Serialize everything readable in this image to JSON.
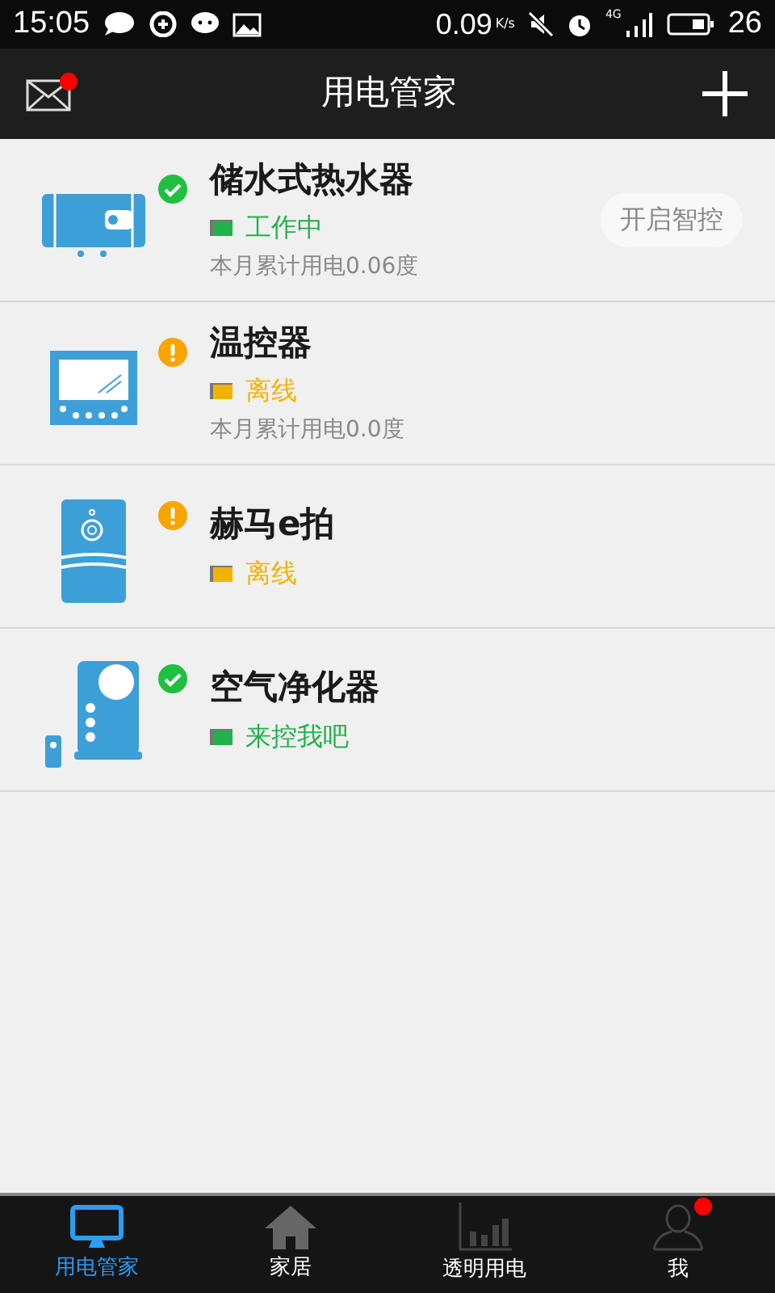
{
  "status_bar": {
    "time": "15:05",
    "speed": "0.09",
    "speed_unit": "K/s",
    "network": "4G",
    "battery": "26"
  },
  "header": {
    "title": "用电管家",
    "mail_badge": true
  },
  "devices": [
    {
      "kind": "water_heater",
      "name": "储水式热水器",
      "online": true,
      "status": "工作中",
      "color": "#22b14c",
      "usage": "本月累计用电0.06度",
      "action": "开启智控"
    },
    {
      "kind": "thermostat",
      "name": "温控器",
      "online": false,
      "status": "离线",
      "color": "#f0b400",
      "usage": "本月累计用电0.0度"
    },
    {
      "kind": "camera",
      "name": "赫马e拍",
      "online": false,
      "status": "离线",
      "color": "#f0b400"
    },
    {
      "kind": "air_purifier",
      "name": "空气净化器",
      "online": true,
      "status": "来控我吧",
      "color": "#22b14c"
    }
  ],
  "nav": [
    {
      "kind": "monitor",
      "label": "用电管家",
      "selected": true,
      "badge": false
    },
    {
      "kind": "home",
      "label": "家居",
      "selected": false,
      "badge": false
    },
    {
      "kind": "chart",
      "label": "透明用电",
      "selected": false,
      "badge": false
    },
    {
      "kind": "person",
      "label": "我",
      "selected": false,
      "badge": true
    }
  ]
}
